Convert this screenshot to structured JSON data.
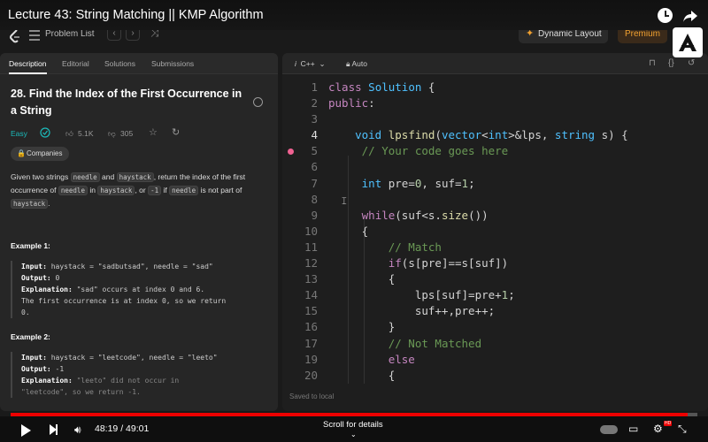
{
  "video": {
    "title": "Lecture 43: String Matching || KMP Algorithm",
    "time": "48:19 / 49:01",
    "progress": 0.986,
    "scroll_label": "Scroll for details",
    "scroll_chevron": "⌄"
  },
  "nav": {
    "problem_list": "Problem List",
    "prev": "‹",
    "next": "›",
    "shuffle": "⤨",
    "dynamic_layout": "Dynamic Layout",
    "dynamic_icon": "✦",
    "premium": "Premium"
  },
  "tabs": [
    "Description",
    "Editorial",
    "Solutions",
    "Submissions"
  ],
  "problem": {
    "title": "28. Find the Index of the First Occurrence in a String",
    "difficulty": "Easy",
    "likes": "5.1K",
    "dislikes": "305",
    "companies": "Companies",
    "lock_icon": "🔒",
    "desc_parts": [
      "Given two strings ",
      "needle",
      " and ",
      "haystack",
      ", return the index of the first occurrence of ",
      "needle",
      " in ",
      "haystack",
      ", or ",
      "-1",
      " if ",
      "needle",
      " is not part of ",
      "haystack",
      "."
    ],
    "example1_title": "Example 1:",
    "example1": {
      "input_label": "Input:",
      "input": " haystack = \"sadbutsad\", needle = \"sad\"",
      "output_label": "Output:",
      "output": " 0",
      "explanation_label": "Explanation:",
      "explanation": " \"sad\" occurs at index 0 and 6.",
      "explanation2": "The first occurrence is at index 0, so we return",
      "explanation3": "0."
    },
    "example2_title": "Example 2:",
    "example2": {
      "input_label": "Input:",
      "input": " haystack = \"leetcode\", needle = \"leeto\"",
      "output_label": "Output:",
      "output": " -1",
      "explanation_label": "Explanation:",
      "explanation": " \"leeto\" did not occur in",
      "explanation2": "\"leetcode\", so we return -1."
    }
  },
  "editor": {
    "lang_prefix": "i",
    "lang": "C++",
    "lang_chevron": "⌄",
    "auto": "Auto",
    "saved": "Saved to local",
    "line_numbers": [
      "1",
      "2",
      "3",
      "4",
      "5",
      "6",
      "7",
      "8",
      "9",
      "10",
      "11",
      "12",
      "13",
      "14",
      "15",
      "16",
      "17",
      "19",
      "20"
    ]
  },
  "icons": {
    "bookmark": "🔖",
    "braces": "{}",
    "reset": "↺",
    "volume": "🔊",
    "captions": "▭",
    "settings": "⚙",
    "fullscreen": "⤡"
  },
  "colors": {
    "accent": "#ff0000",
    "easy": "#1cbaba",
    "premium": "#f0a030"
  }
}
